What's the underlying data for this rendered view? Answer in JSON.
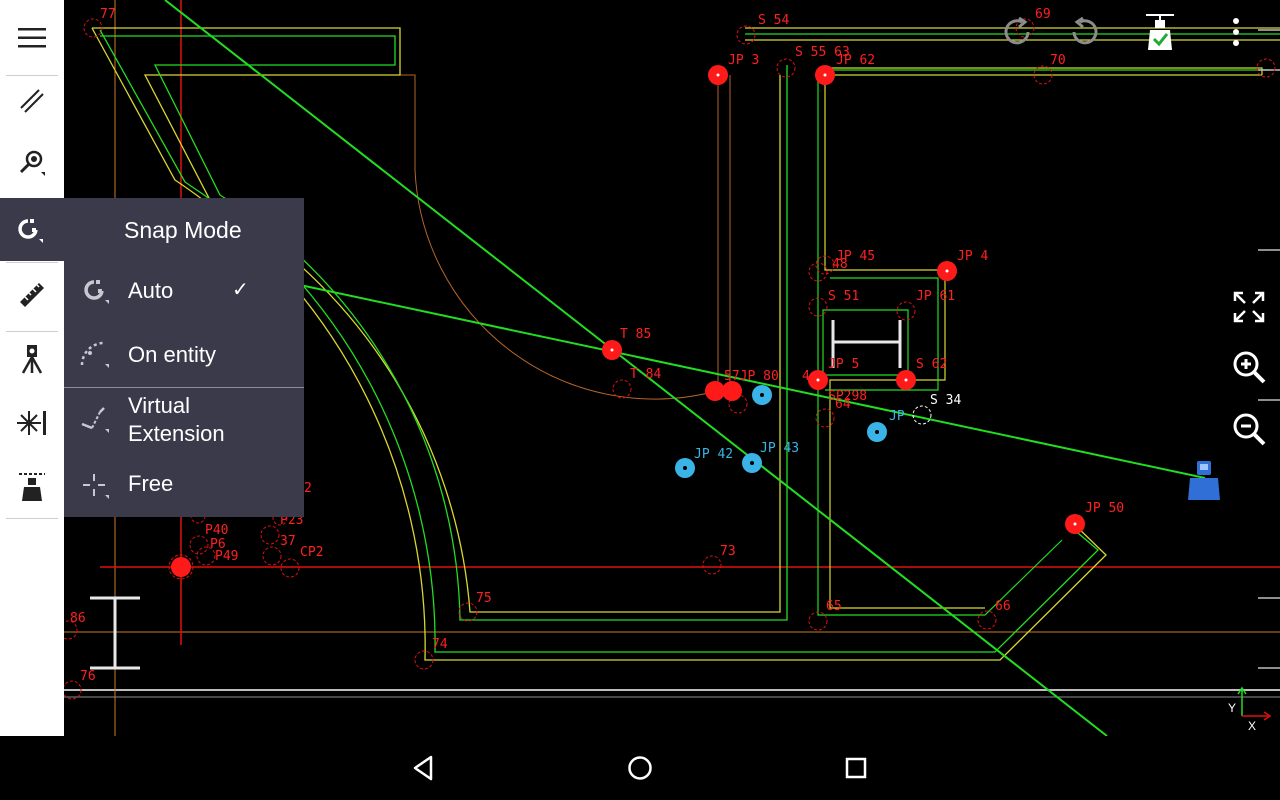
{
  "snap_mode": {
    "title": "Snap Mode",
    "options": [
      {
        "label": "Auto",
        "selected": true
      },
      {
        "label": "On entity",
        "selected": false
      },
      {
        "label": "Virtual\nExtension",
        "selected": false
      },
      {
        "label": "Free",
        "selected": false
      }
    ],
    "check_glyph": "✓"
  },
  "sidebar": {
    "items": [
      {
        "icon": "hamburger-menu-icon"
      },
      {
        "icon": "line-tool-icon"
      },
      {
        "icon": "search-zoom-icon"
      },
      {
        "icon": "snap-magnet-icon",
        "active": true
      },
      {
        "icon": "measure-ruler-icon"
      },
      {
        "icon": "survey-tripod-icon"
      },
      {
        "icon": "laser-target-icon"
      },
      {
        "icon": "layout-marker-icon"
      }
    ]
  },
  "toolbar": {
    "items": [
      {
        "icon": "redo-icon"
      },
      {
        "icon": "undo-icon"
      },
      {
        "icon": "marker-check-icon"
      },
      {
        "icon": "more-options-icon"
      }
    ]
  },
  "right_tools": [
    {
      "icon": "fullscreen-expand-icon"
    },
    {
      "icon": "zoom-in-icon"
    },
    {
      "icon": "zoom-out-icon"
    }
  ],
  "axis": {
    "x": "X",
    "y": "Y"
  },
  "drawing_labels": [
    "77",
    "S 54",
    "69",
    "JP 3",
    "S 55 63",
    "JP 62",
    "70",
    "JP 45",
    "48",
    "JP 4",
    "S 51",
    "JP 61",
    "T 85",
    "T 84",
    "JP 5",
    "S 62",
    "57JP 80",
    "4",
    "SP298",
    "64",
    "S 34",
    "JP",
    "JP 42",
    "JP 43",
    "JP 50",
    "73",
    "75",
    "65",
    "66",
    "74",
    "86",
    "76",
    "P40",
    "P6",
    "P49",
    "P23",
    "37",
    "CP2",
    "2"
  ],
  "colors": {
    "menu_bg": "#3a3a4a",
    "sidebar_bg": "#ffffff",
    "canvas_bg": "#000000",
    "point_red": "#ff1a1a",
    "point_blue": "#3ab4e6",
    "line_green": "#22dd22",
    "line_yellow": "#d8d830",
    "line_red": "#e01010",
    "marker_blue": "#2f6fd6"
  },
  "nav": [
    {
      "icon": "back-triangle-icon"
    },
    {
      "icon": "home-circle-icon"
    },
    {
      "icon": "recent-apps-square-icon"
    }
  ]
}
